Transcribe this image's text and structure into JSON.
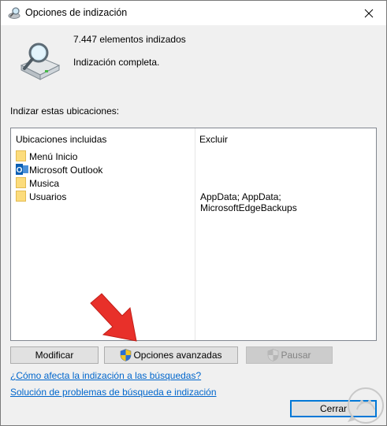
{
  "window": {
    "title": "Opciones de indización"
  },
  "status": {
    "count_text": "7.447 elementos indizados",
    "state_text": "Indización completa."
  },
  "locations": {
    "label": "Indizar estas ubicaciones:",
    "columns": {
      "included": "Ubicaciones incluidas",
      "exclude": "Excluir"
    },
    "rows": [
      {
        "label": "Menú Inicio",
        "exclude": "",
        "icon": "folder-icon"
      },
      {
        "label": "Microsoft Outlook",
        "exclude": "",
        "icon": "outlook-icon"
      },
      {
        "label": "Musica",
        "exclude": "",
        "icon": "folder-icon"
      },
      {
        "label": "Usuarios",
        "exclude": "AppData; AppData; MicrosoftEdgeBackups",
        "icon": "folder-icon"
      }
    ]
  },
  "buttons": {
    "modify": "Modificar",
    "advanced": "Opciones avanzadas",
    "pause": "Pausar",
    "close": "Cerrar"
  },
  "links": {
    "how_it_affects": "¿Cómo afecta la indización a las búsquedas?",
    "troubleshoot": "Solución de problemas de búsqueda e indización"
  },
  "colors": {
    "accent": "#0078d7",
    "link": "#0066cc",
    "annotation_arrow": "#e8302a"
  }
}
